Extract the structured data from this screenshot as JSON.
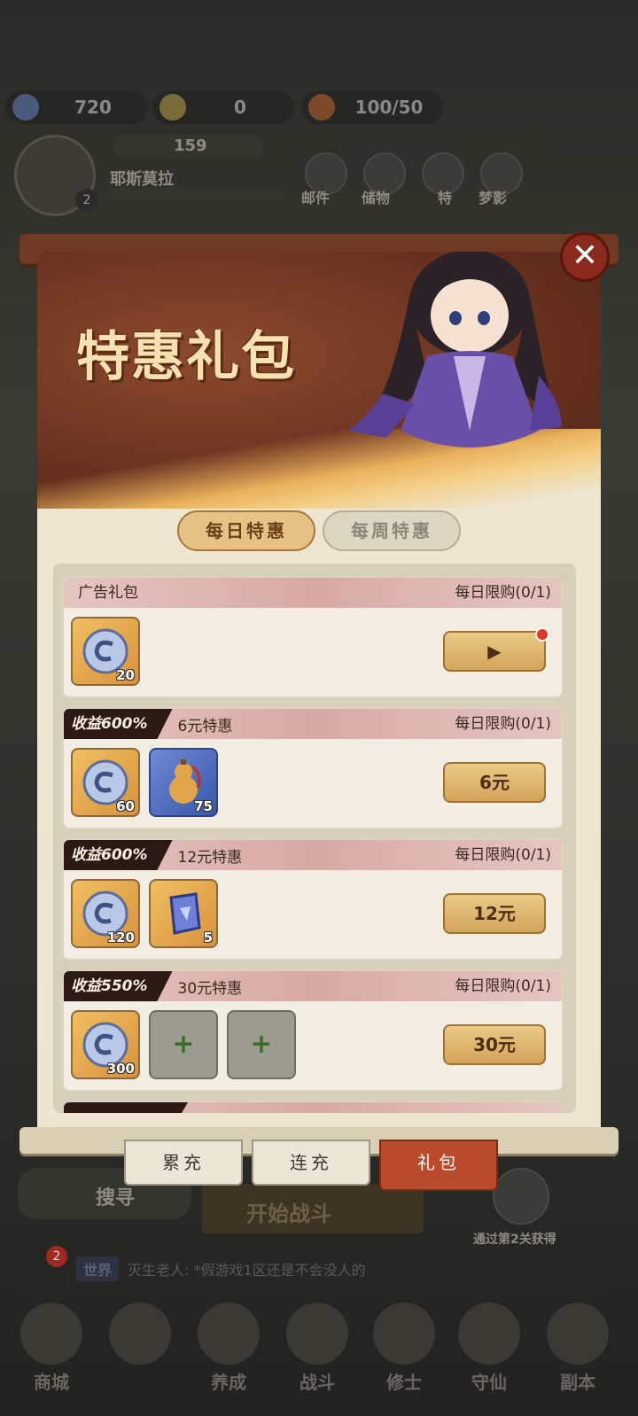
{
  "top_bar": {
    "gems": "720",
    "tickets": "0",
    "stamina": "100/50",
    "player_name": "耶斯莫拉",
    "power": "159",
    "player_level": "2",
    "menu": [
      "邮件",
      "储物",
      "特",
      "梦影"
    ]
  },
  "modal": {
    "title": "特惠礼包",
    "close_symbol": "✕",
    "tabs": [
      {
        "label": "每日特惠",
        "active": true
      },
      {
        "label": "每周特惠",
        "active": false
      }
    ],
    "offers": [
      {
        "tag": "广告礼包",
        "name": "",
        "limit": "每日限购(0/1)",
        "items": [
          {
            "icon": "spirit-jade-icon",
            "count": "20",
            "style": "gold"
          }
        ],
        "button": "▶",
        "has_red_dot": true
      },
      {
        "tag": "收益600%",
        "name": "6元特惠",
        "limit": "每日限购(0/1)",
        "items": [
          {
            "icon": "spirit-jade-icon",
            "count": "60",
            "style": "gold"
          },
          {
            "icon": "gourd-icon",
            "count": "75",
            "style": "blue"
          }
        ],
        "button": "6元"
      },
      {
        "tag": "收益600%",
        "name": "12元特惠",
        "limit": "每日限购(0/1)",
        "items": [
          {
            "icon": "spirit-jade-icon",
            "count": "120",
            "style": "gold"
          },
          {
            "icon": "talisman-icon",
            "count": "5",
            "style": "gold"
          }
        ],
        "button": "12元"
      },
      {
        "tag": "收益550%",
        "name": "30元特惠",
        "limit": "每日限购(0/1)",
        "items": [
          {
            "icon": "spirit-jade-icon",
            "count": "300",
            "style": "gold"
          },
          {
            "icon": "plus-icon",
            "count": "",
            "style": "empty"
          },
          {
            "icon": "plus-icon",
            "count": "",
            "style": "empty"
          }
        ],
        "button": "30元"
      }
    ]
  },
  "bottom_tabs": [
    {
      "label": "累充",
      "active": false
    },
    {
      "label": "连充",
      "active": false
    },
    {
      "label": "礼包",
      "active": true
    }
  ],
  "background": {
    "search_button": "搜寻",
    "start_battle": "开始战斗",
    "reward_hint": "通过第2关获得",
    "chat_badge": "2",
    "chat_channel": "世界",
    "chat_message": "灭生老人: *假游戏1区还是不会没人的",
    "nav": [
      "商城",
      "",
      "养成",
      "战斗",
      "修士",
      "守仙",
      "副本"
    ]
  },
  "colors": {
    "accent": "#b94a2c",
    "button_gold": "#e0b56e",
    "panel_bg": "#ede6d2"
  }
}
